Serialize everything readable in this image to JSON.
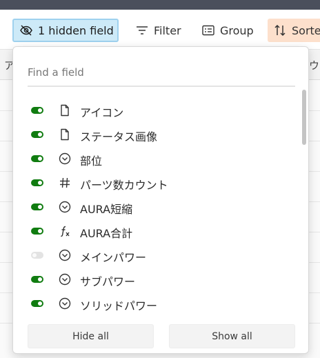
{
  "toolbar": {
    "hidden_fields_label": "1 hidden field",
    "filter_label": "Filter",
    "group_label": "Group",
    "sort_label": "Sorte"
  },
  "grid": {
    "left_header_partial": "ア",
    "right_header_partial": "ウ"
  },
  "popover": {
    "search_placeholder": "Find a field",
    "fields": [
      {
        "label": "アイコン",
        "icon": "file-icon",
        "visible": true
      },
      {
        "label": "ステータス画像",
        "icon": "file-icon",
        "visible": true
      },
      {
        "label": "部位",
        "icon": "single-select-icon",
        "visible": true
      },
      {
        "label": "パーツ数カウント",
        "icon": "number-icon",
        "visible": true
      },
      {
        "label": "AURA短縮",
        "icon": "single-select-icon",
        "visible": true
      },
      {
        "label": "AURA合計",
        "icon": "formula-icon",
        "visible": true
      },
      {
        "label": "メインパワー",
        "icon": "single-select-icon",
        "visible": false
      },
      {
        "label": "サブパワー",
        "icon": "single-select-icon",
        "visible": true
      },
      {
        "label": "ソリッドパワー",
        "icon": "single-select-icon",
        "visible": true
      }
    ],
    "hide_all_label": "Hide all",
    "show_all_label": "Show all"
  },
  "colors": {
    "toggle_on": "#107c10",
    "toggle_off": "#e3e3e3",
    "hidden_button_bg": "#cdeaf8",
    "sort_button_bg": "#fde0cc"
  }
}
